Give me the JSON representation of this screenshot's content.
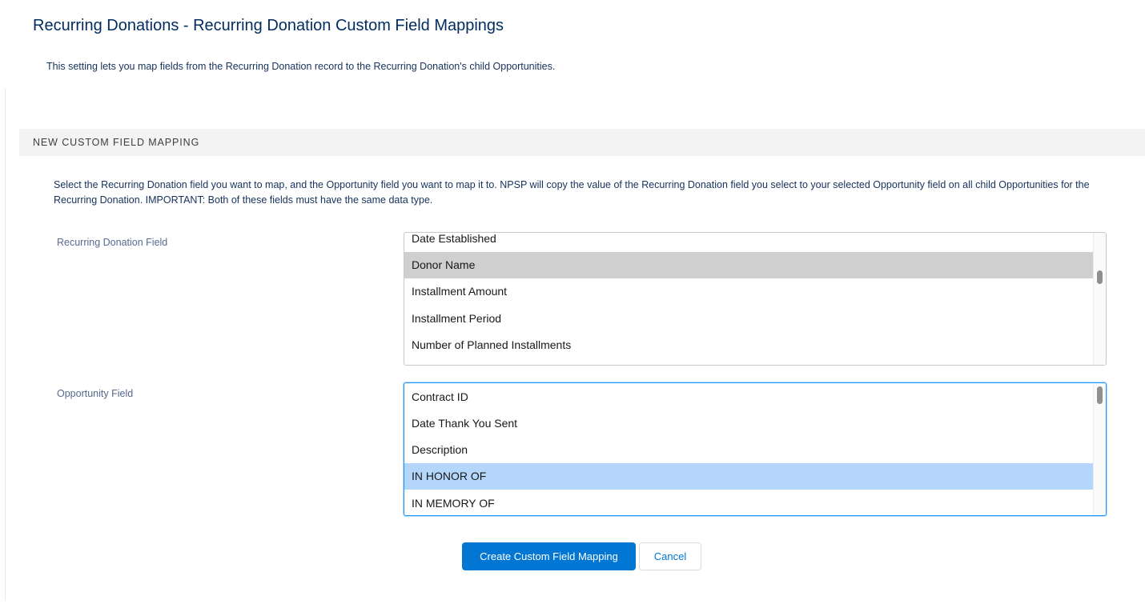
{
  "page": {
    "title": "Recurring Donations - Recurring Donation Custom Field Mappings",
    "description": "This setting lets you map fields from the Recurring Donation record to the Recurring Donation's child Opportunities."
  },
  "section": {
    "header": "NEW CUSTOM FIELD MAPPING",
    "instructions": "Select the Recurring Donation field you want to map, and the Opportunity field you want to map it to. NPSP will copy the value of the Recurring Donation field you select to your selected Opportunity field on all child Opportunities for the Recurring Donation. IMPORTANT: Both of these fields must have the same data type."
  },
  "recurring_donation_field": {
    "label": "Recurring Donation Field",
    "visible_options": [
      {
        "label": "Date Established",
        "selected": false
      },
      {
        "label": "Donor Name",
        "selected": true
      },
      {
        "label": "Installment Amount",
        "selected": false
      },
      {
        "label": "Installment Period",
        "selected": false
      },
      {
        "label": "Number of Planned Installments",
        "selected": false
      }
    ],
    "focused": false
  },
  "opportunity_field": {
    "label": "Opportunity Field",
    "visible_options": [
      {
        "label": "Contract ID",
        "selected": false
      },
      {
        "label": "Date Thank You Sent",
        "selected": false
      },
      {
        "label": "Description",
        "selected": false
      },
      {
        "label": "IN HONOR OF",
        "selected": true
      },
      {
        "label": "IN MEMORY OF",
        "selected": false
      }
    ],
    "focused": true
  },
  "actions": {
    "create_label": "Create Custom Field Mapping",
    "cancel_label": "Cancel"
  },
  "colors": {
    "primary_button": "#0176d3",
    "title_text": "#032d60",
    "selected_option_unfocused": "#cfcfcf",
    "selected_option_focused": "#b4d6fb",
    "section_header_bg": "#f3f3f3",
    "focus_ring": "#1b96ff"
  }
}
